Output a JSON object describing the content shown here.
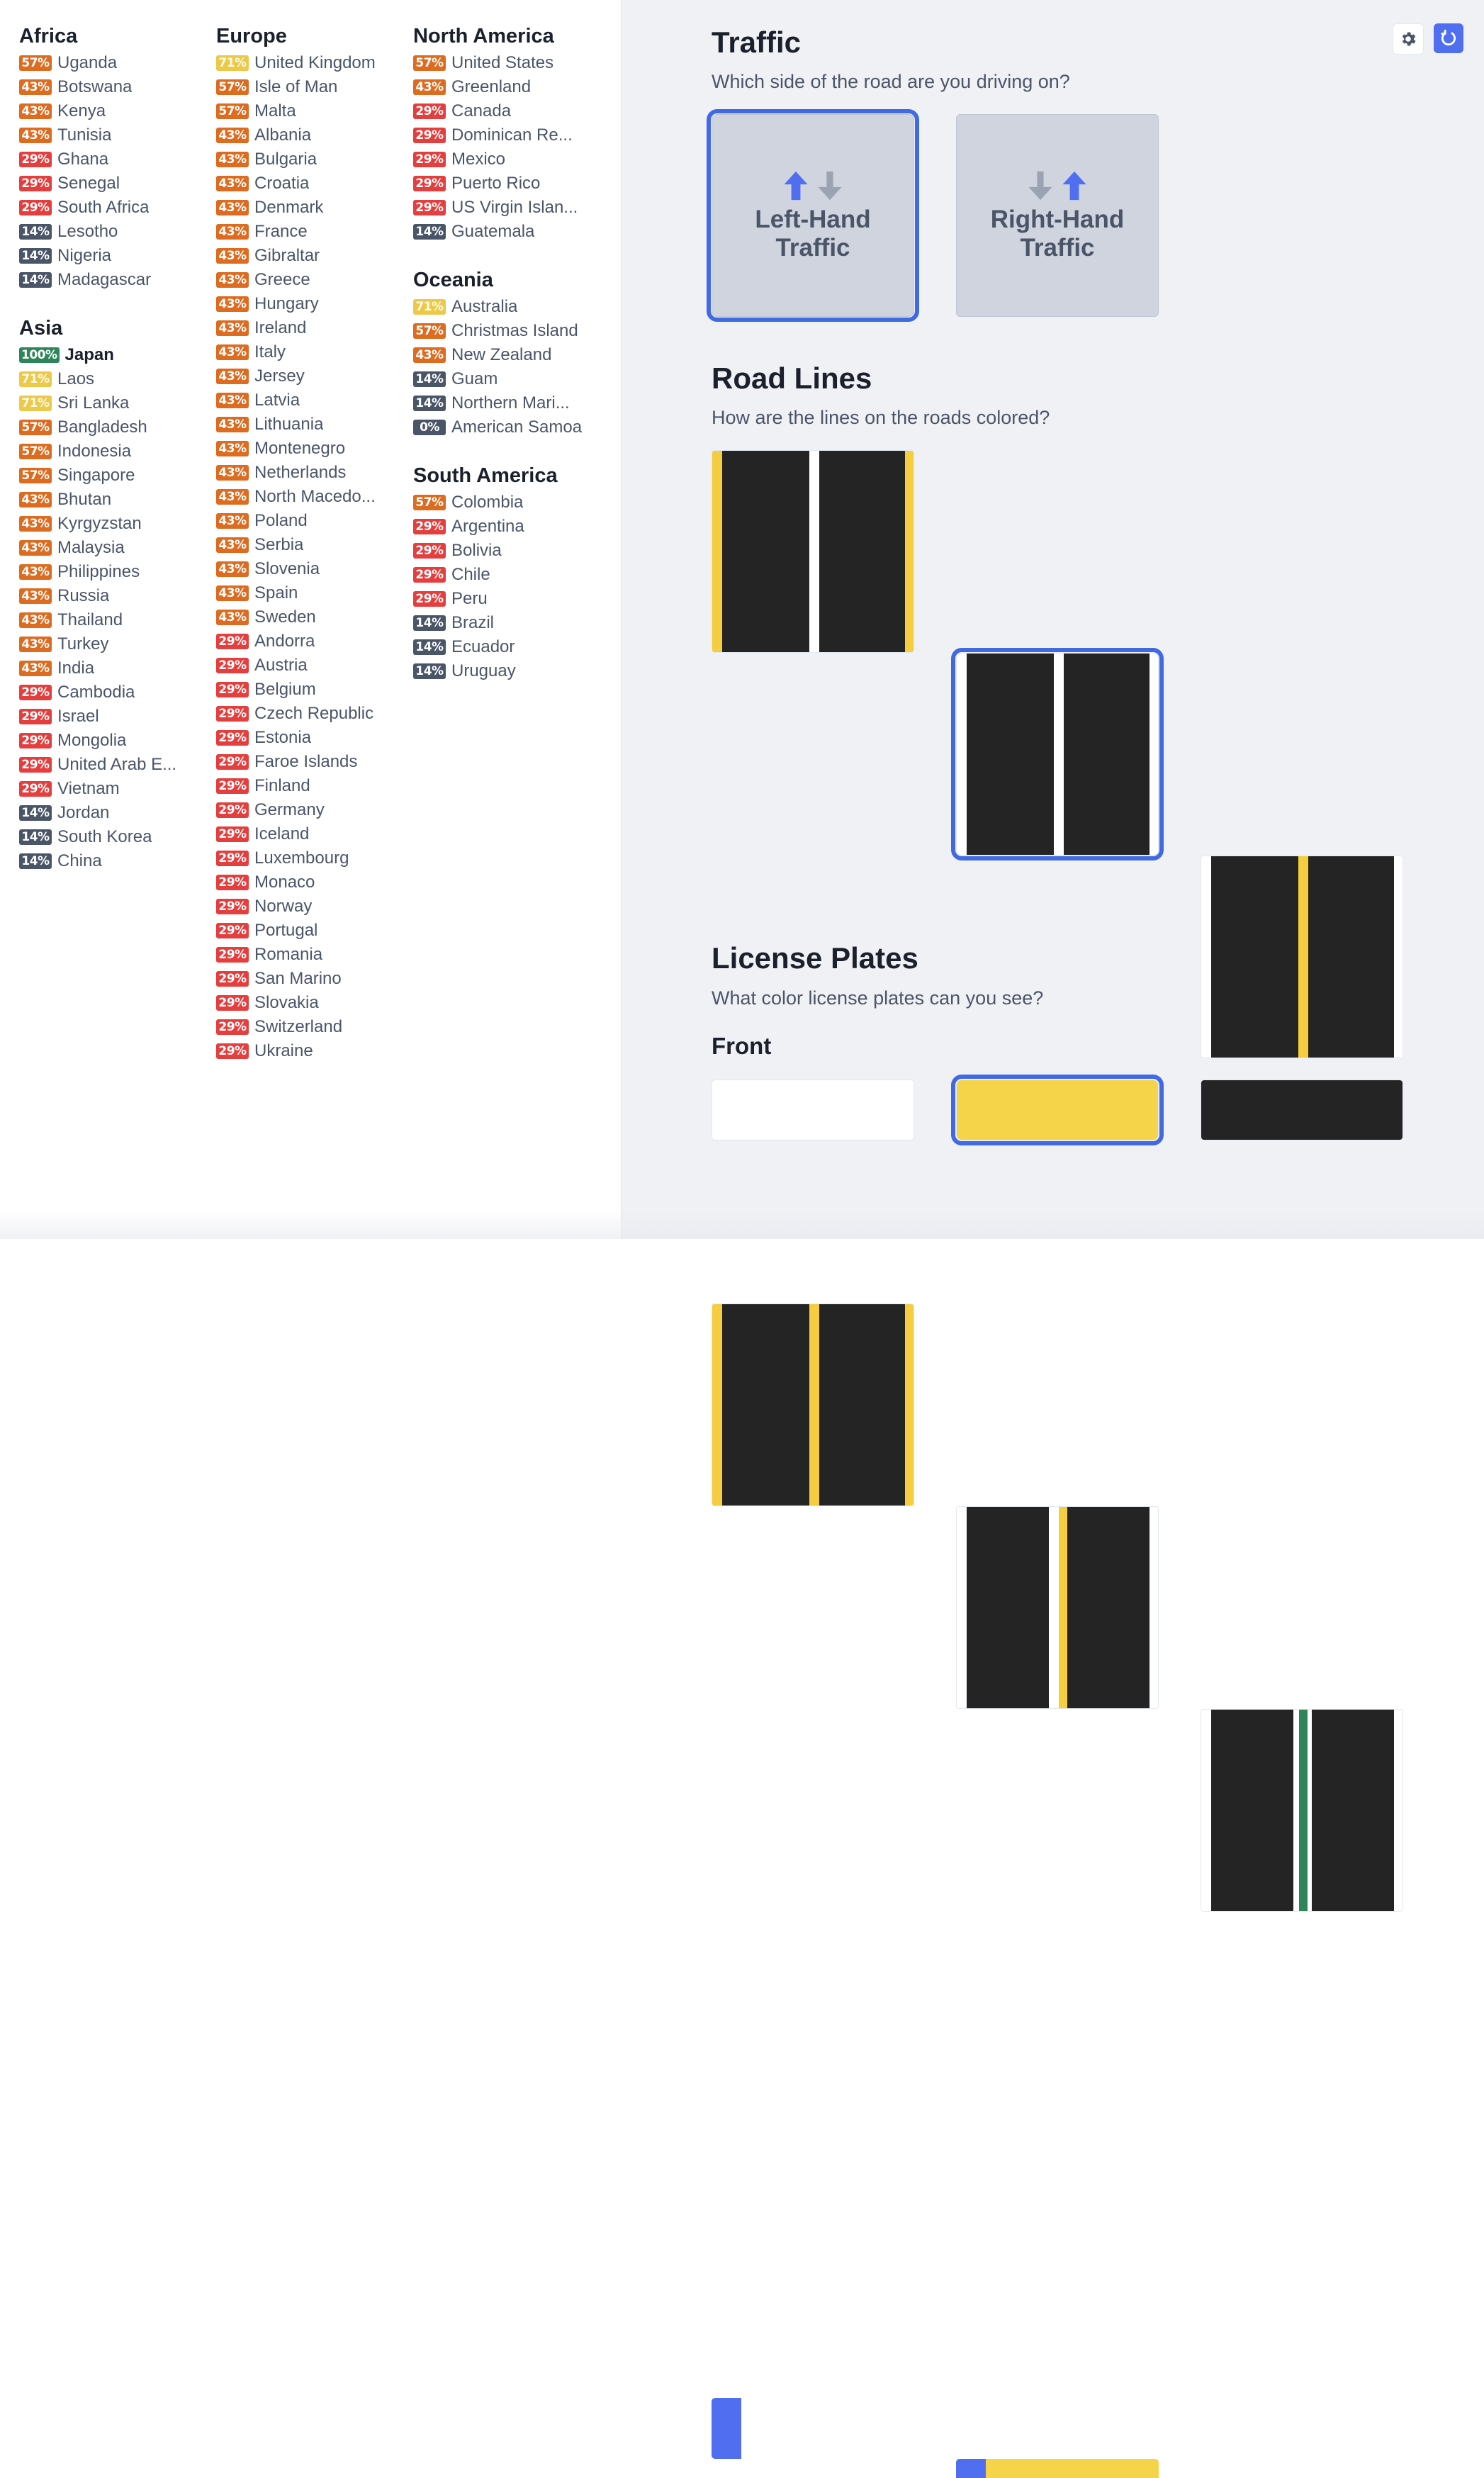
{
  "results": {
    "columns": [
      [
        {
          "region": "Africa",
          "countries": [
            {
              "pct": "57%",
              "name": "Uganda"
            },
            {
              "pct": "43%",
              "name": "Botswana"
            },
            {
              "pct": "43%",
              "name": "Kenya"
            },
            {
              "pct": "43%",
              "name": "Tunisia"
            },
            {
              "pct": "29%",
              "name": "Ghana"
            },
            {
              "pct": "29%",
              "name": "Senegal"
            },
            {
              "pct": "29%",
              "name": "South Africa"
            },
            {
              "pct": "14%",
              "name": "Lesotho"
            },
            {
              "pct": "14%",
              "name": "Nigeria"
            },
            {
              "pct": "14%",
              "name": "Madagascar"
            }
          ]
        },
        {
          "region": "Asia",
          "countries": [
            {
              "pct": "100%",
              "name": "Japan",
              "top": true
            },
            {
              "pct": "71%",
              "name": "Laos"
            },
            {
              "pct": "71%",
              "name": "Sri Lanka"
            },
            {
              "pct": "57%",
              "name": "Bangladesh"
            },
            {
              "pct": "57%",
              "name": "Indonesia"
            },
            {
              "pct": "57%",
              "name": "Singapore"
            },
            {
              "pct": "43%",
              "name": "Bhutan"
            },
            {
              "pct": "43%",
              "name": "Kyrgyzstan"
            },
            {
              "pct": "43%",
              "name": "Malaysia"
            },
            {
              "pct": "43%",
              "name": "Philippines"
            },
            {
              "pct": "43%",
              "name": "Russia"
            },
            {
              "pct": "43%",
              "name": "Thailand"
            },
            {
              "pct": "43%",
              "name": "Turkey"
            },
            {
              "pct": "43%",
              "name": "India"
            },
            {
              "pct": "29%",
              "name": "Cambodia"
            },
            {
              "pct": "29%",
              "name": "Israel"
            },
            {
              "pct": "29%",
              "name": "Mongolia"
            },
            {
              "pct": "29%",
              "name": "United Arab E..."
            },
            {
              "pct": "29%",
              "name": "Vietnam"
            },
            {
              "pct": "14%",
              "name": "Jordan"
            },
            {
              "pct": "14%",
              "name": "South Korea"
            },
            {
              "pct": "14%",
              "name": "China"
            }
          ]
        }
      ],
      [
        {
          "region": "Europe",
          "countries": [
            {
              "pct": "71%",
              "name": "United Kingdom"
            },
            {
              "pct": "57%",
              "name": "Isle of Man"
            },
            {
              "pct": "57%",
              "name": "Malta"
            },
            {
              "pct": "43%",
              "name": "Albania"
            },
            {
              "pct": "43%",
              "name": "Bulgaria"
            },
            {
              "pct": "43%",
              "name": "Croatia"
            },
            {
              "pct": "43%",
              "name": "Denmark"
            },
            {
              "pct": "43%",
              "name": "France"
            },
            {
              "pct": "43%",
              "name": "Gibraltar"
            },
            {
              "pct": "43%",
              "name": "Greece"
            },
            {
              "pct": "43%",
              "name": "Hungary"
            },
            {
              "pct": "43%",
              "name": "Ireland"
            },
            {
              "pct": "43%",
              "name": "Italy"
            },
            {
              "pct": "43%",
              "name": "Jersey"
            },
            {
              "pct": "43%",
              "name": "Latvia"
            },
            {
              "pct": "43%",
              "name": "Lithuania"
            },
            {
              "pct": "43%",
              "name": "Montenegro"
            },
            {
              "pct": "43%",
              "name": "Netherlands"
            },
            {
              "pct": "43%",
              "name": "North Macedo..."
            },
            {
              "pct": "43%",
              "name": "Poland"
            },
            {
              "pct": "43%",
              "name": "Serbia"
            },
            {
              "pct": "43%",
              "name": "Slovenia"
            },
            {
              "pct": "43%",
              "name": "Spain"
            },
            {
              "pct": "43%",
              "name": "Sweden"
            },
            {
              "pct": "29%",
              "name": "Andorra"
            },
            {
              "pct": "29%",
              "name": "Austria"
            },
            {
              "pct": "29%",
              "name": "Belgium"
            },
            {
              "pct": "29%",
              "name": "Czech Republic"
            },
            {
              "pct": "29%",
              "name": "Estonia"
            },
            {
              "pct": "29%",
              "name": "Faroe Islands"
            },
            {
              "pct": "29%",
              "name": "Finland"
            },
            {
              "pct": "29%",
              "name": "Germany"
            },
            {
              "pct": "29%",
              "name": "Iceland"
            },
            {
              "pct": "29%",
              "name": "Luxembourg"
            },
            {
              "pct": "29%",
              "name": "Monaco"
            },
            {
              "pct": "29%",
              "name": "Norway"
            },
            {
              "pct": "29%",
              "name": "Portugal"
            },
            {
              "pct": "29%",
              "name": "Romania"
            },
            {
              "pct": "29%",
              "name": "San Marino"
            },
            {
              "pct": "29%",
              "name": "Slovakia"
            },
            {
              "pct": "29%",
              "name": "Switzerland"
            },
            {
              "pct": "29%",
              "name": "Ukraine"
            }
          ]
        }
      ],
      [
        {
          "region": "North America",
          "countries": [
            {
              "pct": "57%",
              "name": "United States"
            },
            {
              "pct": "43%",
              "name": "Greenland"
            },
            {
              "pct": "29%",
              "name": "Canada"
            },
            {
              "pct": "29%",
              "name": "Dominican Re..."
            },
            {
              "pct": "29%",
              "name": "Mexico"
            },
            {
              "pct": "29%",
              "name": "Puerto Rico"
            },
            {
              "pct": "29%",
              "name": "US Virgin Islan..."
            },
            {
              "pct": "14%",
              "name": "Guatemala"
            }
          ]
        },
        {
          "region": "Oceania",
          "countries": [
            {
              "pct": "71%",
              "name": "Australia"
            },
            {
              "pct": "57%",
              "name": "Christmas Island"
            },
            {
              "pct": "43%",
              "name": "New Zealand"
            },
            {
              "pct": "14%",
              "name": "Guam"
            },
            {
              "pct": "14%",
              "name": "Northern Mari..."
            },
            {
              "pct": "0%",
              "name": "American Samoa"
            }
          ]
        },
        {
          "region": "South America",
          "countries": [
            {
              "pct": "57%",
              "name": "Colombia"
            },
            {
              "pct": "29%",
              "name": "Argentina"
            },
            {
              "pct": "29%",
              "name": "Bolivia"
            },
            {
              "pct": "29%",
              "name": "Chile"
            },
            {
              "pct": "29%",
              "name": "Peru"
            },
            {
              "pct": "14%",
              "name": "Brazil"
            },
            {
              "pct": "14%",
              "name": "Ecuador"
            },
            {
              "pct": "14%",
              "name": "Uruguay"
            }
          ]
        }
      ]
    ]
  },
  "badge_colors": {
    "100": "#2f855a",
    "71": "#ecc94b",
    "57": "#dd6b20",
    "43": "#dd6b20",
    "29": "#e53e3e",
    "14": "#4a5568",
    "0": "#4a5568"
  },
  "quiz": {
    "toolbar": {
      "settings_icon": "gear-icon",
      "reset_icon": "refresh-icon"
    },
    "traffic": {
      "title": "Traffic",
      "question": "Which side of the road are you driving on?",
      "options": [
        {
          "line1": "Left-Hand",
          "line2": "Traffic",
          "selected": true
        },
        {
          "line1": "Right-Hand",
          "line2": "Traffic",
          "selected": false
        }
      ]
    },
    "road_lines": {
      "title": "Road Lines",
      "question": "How are the lines on the roads colored?",
      "options": [
        {
          "edge": "#f6cd3e",
          "center": "#ffffff",
          "selected": false
        },
        {
          "edge": "#ffffff",
          "center": "#ffffff",
          "selected": true
        },
        {
          "edge": "#ffffff",
          "center": "#f6cd3e",
          "selected": false
        },
        {
          "edge": "#f6cd3e",
          "center": "#f6cd3e",
          "selected": false
        },
        {
          "edge": "#ffffff",
          "center": "#ffffff+#f6cd3e",
          "selected": false
        },
        {
          "edge": "#ffffff",
          "center": "#ffffff+#2f855a",
          "selected": false
        }
      ]
    },
    "license_plates": {
      "title": "License Plates",
      "question": "What color license plates can you see?",
      "front_label": "Front",
      "front_options": [
        {
          "color": "#ffffff",
          "selected": false
        },
        {
          "color": "#f6d44a",
          "selected": true
        },
        {
          "color": "#242424",
          "selected": false
        }
      ],
      "band_options": [
        {
          "color": "#ffffff",
          "band": "left"
        },
        {
          "color": "#f6d44a",
          "band": "left"
        },
        {
          "color": "#ffffff",
          "band": "both"
        }
      ]
    }
  }
}
